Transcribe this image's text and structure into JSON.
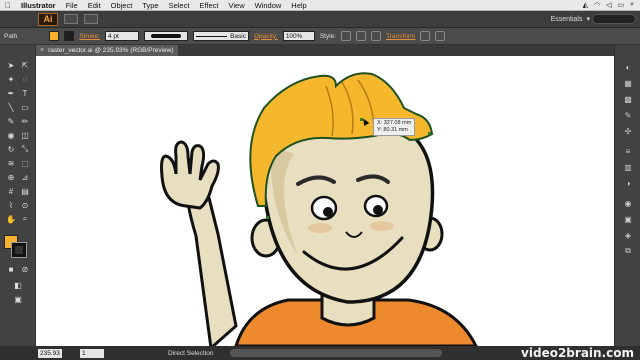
{
  "menubar": {
    "app_name": "Illustrator",
    "items": [
      "File",
      "Edit",
      "Object",
      "Type",
      "Select",
      "Effect",
      "View",
      "Window",
      "Help"
    ]
  },
  "appbar": {
    "logo_text": "Ai",
    "workspace_label": "Essentials"
  },
  "control": {
    "selection_label": "Path",
    "stroke_label": "Stroke:",
    "stroke_weight": "4 pt",
    "stroke_style_label": "Basic",
    "opacity_label": "Opacity:",
    "opacity_value": "100%",
    "style_label": "Style:",
    "transform_label": "Transform",
    "fill_color": "#f7b22f"
  },
  "document": {
    "tab_title": "raster_vector.ai @ 235.93% (RGB/Preview)",
    "close_glyph": "×"
  },
  "readout": {
    "x": "X: 327.08 mm",
    "y": "Y: 80.31 mm"
  },
  "statusbar": {
    "zoom": "235.93",
    "page": "1",
    "status_text": "Direct Selection",
    "watermark": "video2brain.com"
  }
}
